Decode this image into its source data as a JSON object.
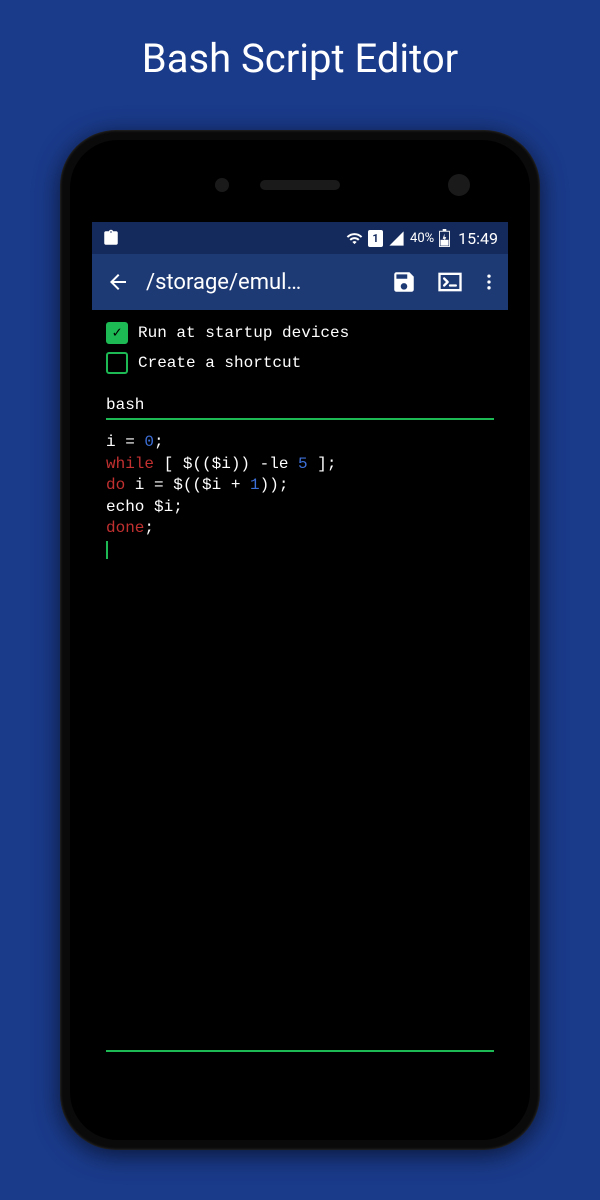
{
  "page_title": "Bash Script Editor",
  "status_bar": {
    "battery_text": "40%",
    "time": "15:49",
    "sim_badge": "1"
  },
  "app_bar": {
    "title": "/storage/emul…"
  },
  "options": {
    "run_startup": {
      "label": "Run at startup devices",
      "checked": true
    },
    "create_shortcut": {
      "label": "Create a shortcut",
      "checked": false
    }
  },
  "language_field": "bash",
  "code": {
    "line1_a": "i = ",
    "line1_num": "0",
    "line1_b": ";",
    "line2_kw": "while",
    "line2_rest": " [ $(($i)) -le ",
    "line2_num": "5",
    "line2_end": " ];",
    "line3_kw": "do",
    "line3_mid": " i = $(($i + ",
    "line3_num": "1",
    "line3_end": "));",
    "line4": "echo $i;",
    "line5_kw": "done",
    "line5_end": ";"
  }
}
